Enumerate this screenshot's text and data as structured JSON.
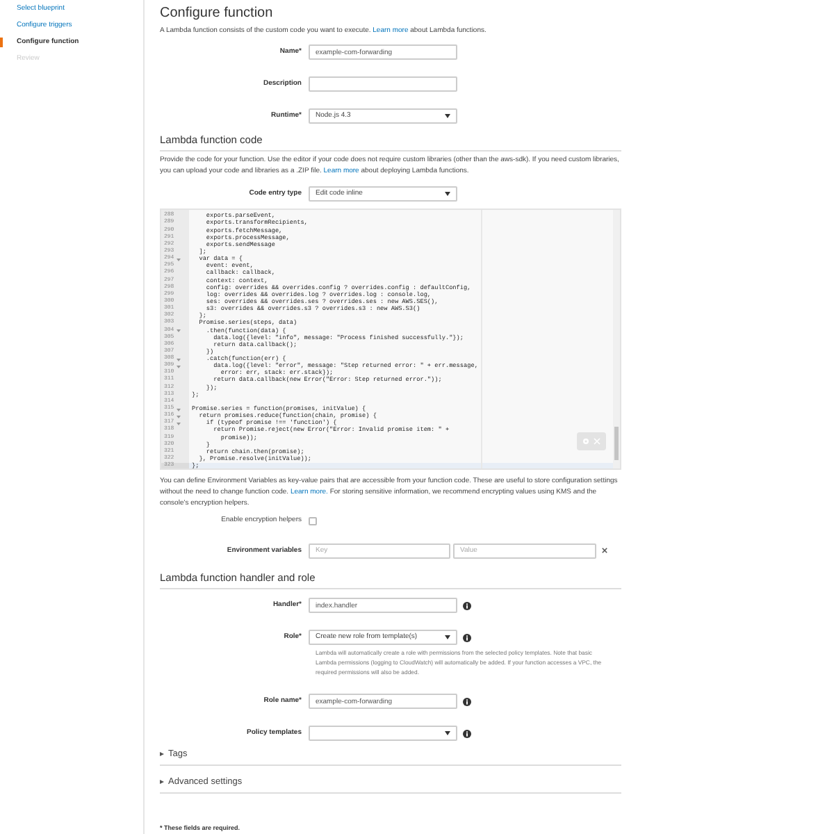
{
  "sidebar": {
    "items": [
      {
        "label": "Select blueprint",
        "selected": false,
        "disabled": false
      },
      {
        "label": "Configure triggers",
        "selected": false,
        "disabled": false
      },
      {
        "label": "Configure function",
        "selected": true,
        "disabled": false
      },
      {
        "label": "Review",
        "selected": false,
        "disabled": true
      }
    ]
  },
  "page": {
    "title": "Configure function",
    "intro": {
      "before": "A Lambda function consists of the custom code you want to execute. ",
      "link": "Learn more",
      "after": " about Lambda functions."
    }
  },
  "basic_fields": [
    {
      "label": "Name*",
      "kind": "text",
      "value": "example-com-forwarding"
    },
    {
      "label": "Description",
      "kind": "text"
    },
    {
      "label": "Runtime*",
      "kind": "select",
      "value": "Node.js 4.3"
    }
  ],
  "code_section": {
    "heading": "Lambda function code",
    "intro": {
      "before": "Provide the code for your function. Use the editor if your code does not require custom libraries (other than the aws-sdk). If you need custom libraries, you can upload your code and libraries as a .ZIP file. ",
      "link": "Learn more",
      "after": " about deploying Lambda functions."
    },
    "entry_type": {
      "label": "Code entry type",
      "value": "Edit code inline"
    },
    "editor": {
      "lines": [
        {
          "number": "288",
          "text": "    exports.parseEvent,",
          "fold": false,
          "active": false
        },
        {
          "number": "289",
          "text": "    exports.transformRecipients,",
          "fold": false,
          "active": false
        },
        {
          "number": "290",
          "text": "    exports.fetchMessage,",
          "fold": false,
          "active": false
        },
        {
          "number": "291",
          "text": "    exports.processMessage,",
          "fold": false,
          "active": false
        },
        {
          "number": "292",
          "text": "    exports.sendMessage",
          "fold": false,
          "active": false
        },
        {
          "number": "293",
          "text": "  ];",
          "fold": false,
          "active": false
        },
        {
          "number": "294",
          "text": "  var data = {",
          "fold": true,
          "active": false
        },
        {
          "number": "295",
          "text": "    event: event,",
          "fold": false,
          "active": false
        },
        {
          "number": "296",
          "text": "    callback: callback,",
          "fold": false,
          "active": false
        },
        {
          "number": "297",
          "text": "    context: context,",
          "fold": false,
          "active": false
        },
        {
          "number": "298",
          "text": "    config: overrides && overrides.config ? overrides.config : defaultConfig,",
          "fold": false,
          "active": false
        },
        {
          "number": "299",
          "text": "    log: overrides && overrides.log ? overrides.log : console.log,",
          "fold": false,
          "active": false
        },
        {
          "number": "300",
          "text": "    ses: overrides && overrides.ses ? overrides.ses : new AWS.SES(),",
          "fold": false,
          "active": false
        },
        {
          "number": "301",
          "text": "    s3: overrides && overrides.s3 ? overrides.s3 : new AWS.S3()",
          "fold": false,
          "active": false
        },
        {
          "number": "302",
          "text": "  };",
          "fold": false,
          "active": false
        },
        {
          "number": "303",
          "text": "  Promise.series(steps, data)",
          "fold": false,
          "active": false
        },
        {
          "number": "304",
          "text": "    .then(function(data) {",
          "fold": true,
          "active": false
        },
        {
          "number": "305",
          "text": "      data.log({level: \"info\", message: \"Process finished successfully.\"});",
          "fold": false,
          "active": false
        },
        {
          "number": "306",
          "text": "      return data.callback();",
          "fold": false,
          "active": false
        },
        {
          "number": "307",
          "text": "    })",
          "fold": false,
          "active": false
        },
        {
          "number": "308",
          "text": "    .catch(function(err) {",
          "fold": true,
          "active": false
        },
        {
          "number": "309",
          "text": "      data.log({level: \"error\", message: \"Step returned error: \" + err.message,",
          "fold": true,
          "active": false
        },
        {
          "number": "310",
          "text": "        error: err, stack: err.stack});",
          "fold": false,
          "active": false
        },
        {
          "number": "311",
          "text": "      return data.callback(new Error(\"Error: Step returned error.\"));",
          "fold": false,
          "active": false
        },
        {
          "number": "312",
          "text": "    });",
          "fold": false,
          "active": false
        },
        {
          "number": "313",
          "text": "};",
          "fold": false,
          "active": false
        },
        {
          "number": "314",
          "fold": false,
          "active": false
        },
        {
          "number": "315",
          "text": "Promise.series = function(promises, initValue) {",
          "fold": true,
          "active": false
        },
        {
          "number": "316",
          "text": "  return promises.reduce(function(chain, promise) {",
          "fold": true,
          "active": false
        },
        {
          "number": "317",
          "text": "    if (typeof promise !== 'function') {",
          "fold": true,
          "active": false
        },
        {
          "number": "318",
          "text": "      return Promise.reject(new Error(\"Error: Invalid promise item: \" +",
          "fold": false,
          "active": false
        },
        {
          "number": "319",
          "text": "        promise));",
          "fold": false,
          "active": false
        },
        {
          "number": "320",
          "text": "    }",
          "fold": false,
          "active": false
        },
        {
          "number": "321",
          "text": "    return chain.then(promise);",
          "fold": false,
          "active": false
        },
        {
          "number": "322",
          "text": "  }, Promise.resolve(initValue));",
          "fold": false,
          "active": false
        },
        {
          "number": "323",
          "text": "};",
          "fold": false,
          "active": true
        }
      ]
    }
  },
  "environment": {
    "intro": {
      "before": "You can define Environment Variables as key-value pairs that are accessible from your function code. These are useful to store configuration settings without the need to change function code. ",
      "link": "Learn more.",
      "after": " For storing sensitive information, we recommend encrypting values using KMS and the console's encryption helpers."
    },
    "encryption": {
      "label": "Enable encryption helpers",
      "checked": false
    },
    "variables": {
      "label": "Environment variables",
      "key_placeholder": "Key",
      "value_placeholder": "Value"
    }
  },
  "handler_section": {
    "heading": "Lambda function handler and role",
    "fields": [
      {
        "label": "Handler*",
        "kind": "text",
        "value": "index.handler"
      },
      {
        "label": "Role*",
        "kind": "select",
        "value": "Create new role from template(s)",
        "help": "Lambda will automatically create a role with permissions from the selected policy templates. Note that basic Lambda permissions (logging to CloudWatch) will automatically be added. If your function accesses a VPC, the required permissions will also be added."
      },
      {
        "label": "Role name*",
        "kind": "text",
        "value": "example-com-forwarding"
      },
      {
        "label": "Policy templates",
        "kind": "select"
      }
    ]
  },
  "collapsibles": [
    {
      "label": "Tags",
      "expanded": false
    },
    {
      "label": "Advanced settings",
      "expanded": false
    }
  ],
  "footer_note": "* These fields are required."
}
